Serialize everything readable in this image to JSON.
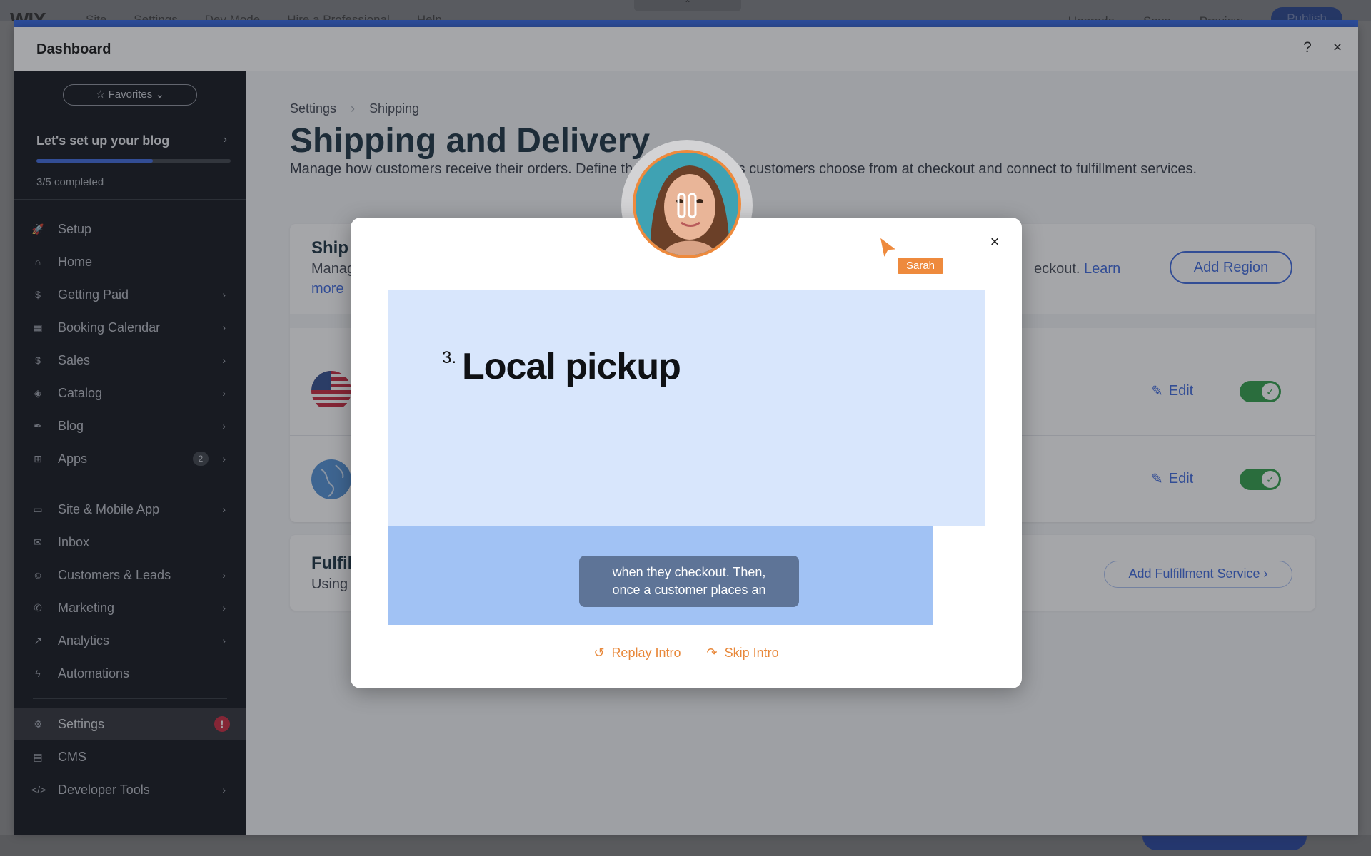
{
  "editor": {
    "logo": "WIX",
    "menu": [
      "Site",
      "Settings",
      "Dev Mode",
      "Hire a Professional",
      "Help"
    ],
    "upgrade": "Upgrade",
    "save": "Save",
    "preview": "Preview",
    "publish": "Publish"
  },
  "dashboard": {
    "title": "Dashboard",
    "help_icon": "?",
    "close_icon": "×"
  },
  "sidebar": {
    "favorites": "Favorites",
    "setup_title": "Let's set up your blog",
    "setup_progress": "3/5 completed",
    "progress_fraction": 0.6,
    "items": [
      {
        "label": "Setup",
        "icon": "rocket-icon",
        "glyph": "🚀",
        "chevron": false
      },
      {
        "label": "Home",
        "icon": "home-icon",
        "glyph": "⌂",
        "chevron": false
      },
      {
        "label": "Getting Paid",
        "icon": "receipt-icon",
        "glyph": "$",
        "chevron": true
      },
      {
        "label": "Booking Calendar",
        "icon": "calendar-icon",
        "glyph": "▦",
        "chevron": true
      },
      {
        "label": "Sales",
        "icon": "dollar-icon",
        "glyph": "$",
        "chevron": true
      },
      {
        "label": "Catalog",
        "icon": "tag-icon",
        "glyph": "◈",
        "chevron": true
      },
      {
        "label": "Blog",
        "icon": "pen-icon",
        "glyph": "✒",
        "chevron": true
      },
      {
        "label": "Apps",
        "icon": "apps-icon",
        "glyph": "⊞",
        "chevron": true,
        "badge": "2"
      }
    ],
    "items2": [
      {
        "label": "Site & Mobile App",
        "icon": "devices-icon",
        "glyph": "▭",
        "chevron": true
      },
      {
        "label": "Inbox",
        "icon": "inbox-icon",
        "glyph": "✉",
        "chevron": false
      },
      {
        "label": "Customers & Leads",
        "icon": "people-icon",
        "glyph": "☺",
        "chevron": true
      },
      {
        "label": "Marketing",
        "icon": "megaphone-icon",
        "glyph": "✆",
        "chevron": true
      },
      {
        "label": "Analytics",
        "icon": "chart-icon",
        "glyph": "↗",
        "chevron": true
      },
      {
        "label": "Automations",
        "icon": "bolt-icon",
        "glyph": "ϟ",
        "chevron": false
      }
    ],
    "items3": [
      {
        "label": "Settings",
        "icon": "gear-icon",
        "glyph": "⚙",
        "chevron": false,
        "alert": "!"
      },
      {
        "label": "CMS",
        "icon": "table-icon",
        "glyph": "▤",
        "chevron": false
      },
      {
        "label": "Developer Tools",
        "icon": "code-icon",
        "glyph": "</>",
        "chevron": true
      }
    ]
  },
  "main": {
    "breadcrumb": [
      "Settings",
      "Shipping"
    ],
    "title": "Shipping and Delivery",
    "description_start": "Manage how customers receive their orders. Define th",
    "description_end": "ptions customers choose from at checkout and connect to fulfillment services.",
    "shipping_card": {
      "title": "Ship",
      "text": "Manag",
      "text_end": "eckout.",
      "learn": "Learn",
      "more": "more",
      "add_region": "Add Region"
    },
    "regions": [
      {
        "flag": "us-flag-icon",
        "edit": "Edit",
        "enabled": true
      },
      {
        "flag": "globe-icon",
        "edit": "Edit",
        "enabled": true
      }
    ],
    "fulfillment_card": {
      "title": "Fulfil",
      "text": "Using",
      "button": "Add Fulfillment Service"
    }
  },
  "modal": {
    "step_number": "3.",
    "step_title": "Local pickup",
    "caption_line1": "when they checkout. Then,",
    "caption_line2": "once a customer places an",
    "replay": "Replay Intro",
    "skip": "Skip Intro",
    "presenter": "Sarah"
  }
}
